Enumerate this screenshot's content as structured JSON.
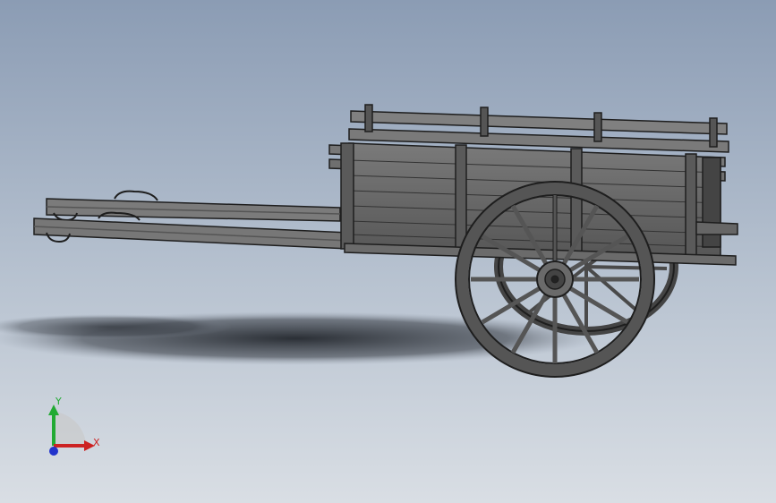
{
  "triad": {
    "x_label": "X",
    "y_label": "Y",
    "x_color": "#cc2222",
    "y_color": "#22aa33",
    "z_color": "#2233cc"
  },
  "colors": {
    "wood": "#6e6e6e",
    "wood_light": "#8a8a8a",
    "wood_dark": "#3e3e3e",
    "outline": "#1e1e1e",
    "shadow": "#2a2e35"
  }
}
